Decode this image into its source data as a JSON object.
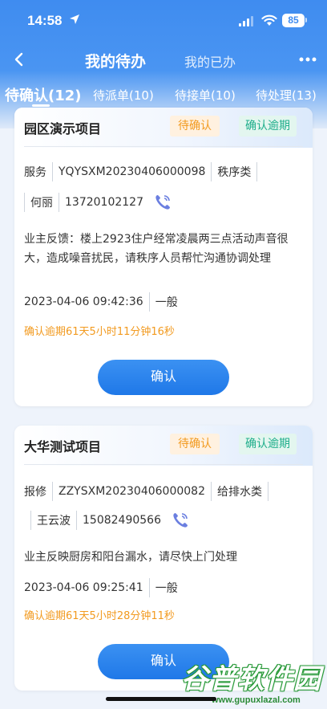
{
  "status_bar": {
    "time": "14:58",
    "battery": "85"
  },
  "nav": {
    "tab_active": "我的待办",
    "tab_inactive": "我的已办"
  },
  "subtabs": [
    "待确认(12)",
    "待派单(10)",
    "待接单(10)",
    "待处理(13)"
  ],
  "cards": [
    {
      "project": "园区演示项目",
      "badge_status": "待确认",
      "badge_overdue": "确认逾期",
      "type": "服务",
      "code": "YQYSXM20230406000098",
      "category": "秩序类",
      "person": "何丽",
      "phone": "13720102127",
      "description": "业主反馈：楼上2923住户经常凌晨两三点活动声音很大，造成噪音扰民，请秩序人员帮忙沟通协调处理",
      "datetime": "2023-04-06 09:42:36",
      "level": "一般",
      "overdue_text": "确认逾期61天5小时11分钟16秒",
      "button": "确认"
    },
    {
      "project": "大华测试项目",
      "badge_status": "待确认",
      "badge_overdue": "确认逾期",
      "type": "报修",
      "code": "ZZYSXM20230406000082",
      "category": "给排水类",
      "person": "王云波",
      "phone": "15082490566",
      "description": "业主反映厨房和阳台漏水，请尽快上门处理",
      "datetime": "2023-04-06 09:25:41",
      "level": "一般",
      "overdue_text": "确认逾期61天5小时28分钟11秒",
      "button": "确认"
    }
  ],
  "watermark": {
    "text": "谷普软件园",
    "url": "www.gupuxlazal.com"
  },
  "colors": {
    "primary": "#3f8cf0",
    "pending": "#f29a1f",
    "overdue": "#1fae8b"
  }
}
